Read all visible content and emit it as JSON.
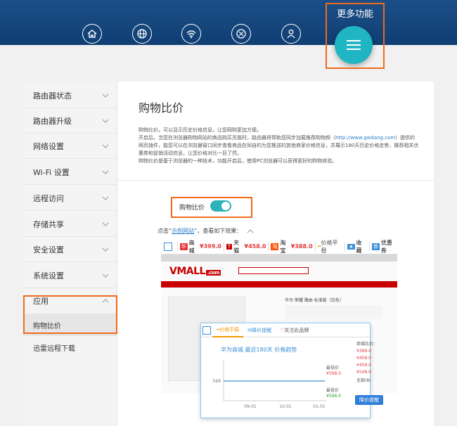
{
  "header": {
    "more_label": "更多功能",
    "nav_icons": [
      "home-icon",
      "globe-icon",
      "wifi-icon",
      "globe-settings-icon",
      "user-icon"
    ]
  },
  "sidebar": {
    "items": [
      {
        "label": "路由器状态"
      },
      {
        "label": "路由器升级"
      },
      {
        "label": "网络设置"
      },
      {
        "label": "Wi-Fi 设置"
      },
      {
        "label": "远程访问"
      },
      {
        "label": "存储共享"
      },
      {
        "label": "安全设置"
      },
      {
        "label": "系统设置"
      },
      {
        "label": "应用"
      }
    ],
    "sub_items": [
      {
        "label": "购物比价"
      },
      {
        "label": "迅雷远程下载"
      }
    ]
  },
  "main": {
    "title": "购物比价",
    "desc_1": "购物比价，可以显示历史价格信息，让您网购更加方便。",
    "desc_2a": "开启后，当您在浏览器购物网站的商品购买页面时，路由器将帮助您同步加载推荐购物频（",
    "desc_link": "http://www.gwdang.com",
    "desc_2b": "）提供的网页插件，能您可以在浏览器窗口同步查看商品在同自的为您推送的其他商家价格信息，并展示180天历史价格走势，推荐相关优惠券和促销活动信息，让您价格对比一目了然。",
    "desc_3": "购物比价是基于浏览器的一种技术，功能开启后，使用PC浏览器可以获得更好的购物体验。",
    "toggle_label": "购物比价",
    "click_prefix": "点击“",
    "click_link": "示例网站",
    "click_suffix": "”，查看如下效果：",
    "preview": {
      "bar": {
        "s1_name": "商城",
        "s1_price": "¥399.0",
        "s2_name": "天猫",
        "s2_price": "¥458.0",
        "s3_name": "淘宝",
        "s3_price": "¥388.0",
        "trend": "价格平稳",
        "fav": "收藏",
        "coupon": "优惠券"
      },
      "logo": "VMALL",
      "logo_sub": ".com",
      "product_title": "华为 荣耀 路由 标准版（白色）",
      "popup": {
        "tabs": [
          "价格平稳",
          "降价提醒",
          "关注此品牌"
        ],
        "chart_title": "华为商城 最近180天 价格趋势",
        "y_value": "599",
        "x_ticks": [
          "09-01",
          "10-01",
          "01-01"
        ],
        "highest_label": "最低价",
        "highest_value": "¥598.0",
        "lowest_label": "最低价",
        "lowest_value": "¥598.0",
        "compare_label": "商城比价：",
        "compare_prices": [
          "¥399.0",
          "¥458.0",
          "¥459.0",
          "¥548.0"
        ],
        "all_label": "全部(8)",
        "notify_button": "降价提醒"
      }
    }
  }
}
